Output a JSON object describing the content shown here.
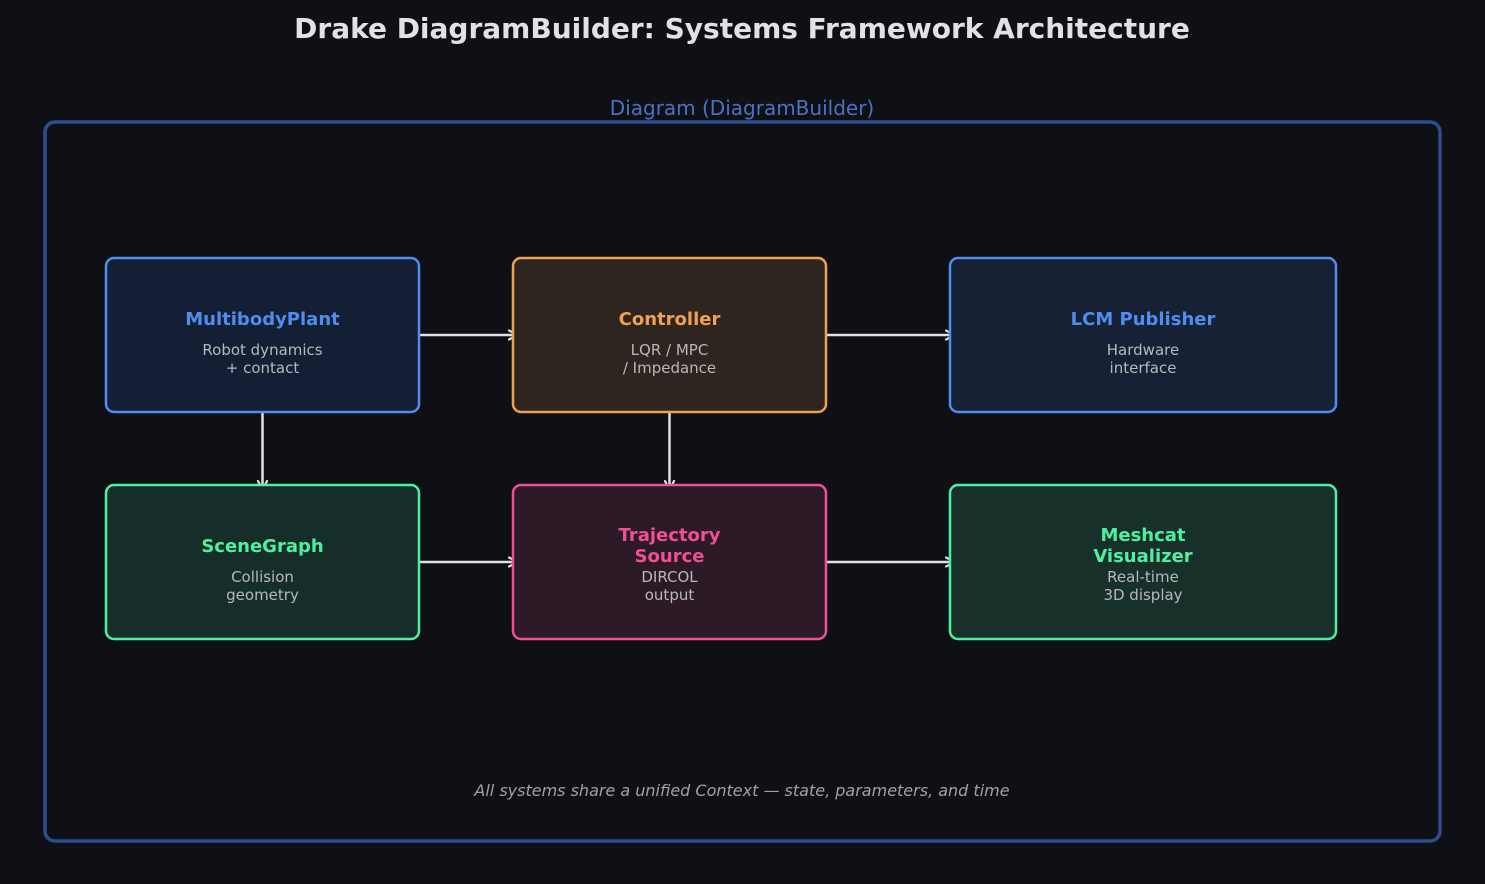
{
  "title": "Drake DiagramBuilder: Systems Framework Architecture",
  "container": {
    "label": "Diagram (DiagramBuilder)",
    "color": "#2d4e8c",
    "label_color": "#4a72c4"
  },
  "footer": "All systems share a unified Context — state, parameters, and time",
  "colors": {
    "background": "#0f1016",
    "arrow": "#e0e0e0",
    "subtitle": "#b8b8bc"
  },
  "nodes": [
    {
      "id": "multibodyplant",
      "title": [
        "MultibodyPlant"
      ],
      "subtitle": [
        "Robot dynamics",
        "+ contact"
      ],
      "stroke": "#4f8ef0",
      "fill": "#141e34",
      "text_color": "#4f8ef0"
    },
    {
      "id": "controller",
      "title": [
        "Controller"
      ],
      "subtitle": [
        "LQR / MPC",
        "/ Impedance"
      ],
      "stroke": "#f0a04f",
      "fill": "#2e2520",
      "text_color": "#f0a04f"
    },
    {
      "id": "lcm-publisher",
      "title": [
        "LCM Publisher"
      ],
      "subtitle": [
        "Hardware",
        "interface"
      ],
      "stroke": "#4f8ef0",
      "fill": "#162136",
      "text_color": "#4f8ef0"
    },
    {
      "id": "scenegraph",
      "title": [
        "SceneGraph"
      ],
      "subtitle": [
        "Collision",
        "geometry"
      ],
      "stroke": "#4ef0a0",
      "fill": "#152e29",
      "text_color": "#4ef0a0"
    },
    {
      "id": "trajectory-source",
      "title": [
        "Trajectory",
        "Source"
      ],
      "subtitle": [
        "DIRCOL",
        "output"
      ],
      "stroke": "#f04f96",
      "fill": "#2d1a27",
      "text_color": "#f04f96"
    },
    {
      "id": "meshcat-visualizer",
      "title": [
        "Meshcat",
        "Visualizer"
      ],
      "subtitle": [
        "Real-time",
        "3D display"
      ],
      "stroke": "#4ef0a0",
      "fill": "#17302a",
      "text_color": "#4ef0a0"
    }
  ],
  "edges": [
    {
      "from": "multibodyplant",
      "to": "controller"
    },
    {
      "from": "controller",
      "to": "lcm-publisher"
    },
    {
      "from": "multibodyplant",
      "to": "scenegraph"
    },
    {
      "from": "controller",
      "to": "trajectory-source"
    },
    {
      "from": "scenegraph",
      "to": "trajectory-source"
    },
    {
      "from": "trajectory-source",
      "to": "meshcat-visualizer"
    }
  ]
}
